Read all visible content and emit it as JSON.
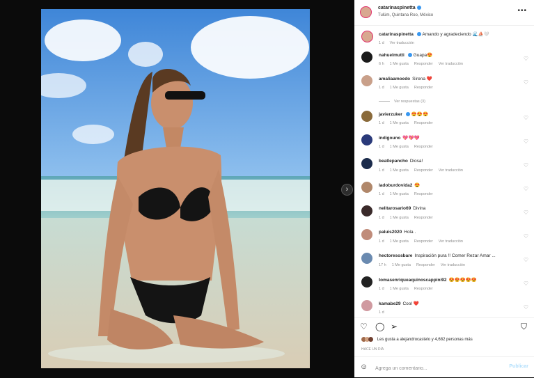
{
  "header": {
    "username": "catarinaspinetta",
    "location": "Tulúm, Quintana Roo, México",
    "more_icon": "more-icon"
  },
  "caption": {
    "username": "catarinaspinetta",
    "text": "Amando y agradeciendo 🌊⛵🤍",
    "time": "1 d",
    "translation": "Ver traducción"
  },
  "comments": [
    {
      "user": "nahuelmutti",
      "verified": true,
      "text": "Guapa😍",
      "time": "6 h",
      "likes": "1 Me gusta",
      "reply": "Responder",
      "translation": "Ver traducción",
      "avatar_color": "#1a1a1a"
    },
    {
      "user": "amaliaamoedo",
      "verified": false,
      "text": "Sirena ❤️",
      "time": "1 d",
      "likes": "1 Me gusta",
      "reply": "Responder",
      "translation": "",
      "avatar_color": "#c9a08a"
    },
    {
      "user": "javierzuker",
      "verified": true,
      "text": "😍😍😍",
      "time": "1 d",
      "likes": "1 Me gusta",
      "reply": "Responder",
      "translation": "",
      "avatar_color": "#8a6a3a"
    },
    {
      "user": "indigouno",
      "verified": false,
      "text": "💖💖💖",
      "time": "1 d",
      "likes": "1 Me gusta",
      "reply": "Responder",
      "translation": "",
      "avatar_color": "#2a3a7a"
    },
    {
      "user": "beatlepancho",
      "verified": false,
      "text": "Diosa!",
      "time": "1 d",
      "likes": "1 Me gusta",
      "reply": "Responder",
      "translation": "Ver traducción",
      "avatar_color": "#1c2c4c"
    },
    {
      "user": "ladoburdovida2",
      "verified": false,
      "text": "😍",
      "time": "1 d",
      "likes": "1 Me gusta",
      "reply": "Responder",
      "translation": "",
      "avatar_color": "#b0876a"
    },
    {
      "user": "nelitarosario69",
      "verified": false,
      "text": "Divina",
      "time": "1 d",
      "likes": "1 Me gusta",
      "reply": "Responder",
      "translation": "",
      "avatar_color": "#3a2a2a"
    },
    {
      "user": "paluis2020",
      "verified": false,
      "text": "Hola .",
      "time": "1 d",
      "likes": "1 Me gusta",
      "reply": "Responder",
      "translation": "Ver traducción",
      "avatar_color": "#c08c7a"
    },
    {
      "user": "hectoresosbare",
      "verified": false,
      "text": "Inspiración pura !! Comer Rezar Amar ...",
      "time": "17 h",
      "likes": "1 Me gusta",
      "reply": "Responder",
      "translation": "Ver traducción",
      "avatar_color": "#6a8ab0"
    },
    {
      "user": "tomasenriqueaquinoscappini92",
      "verified": false,
      "text": "😍😍😍😍😍",
      "time": "1 d",
      "likes": "1 Me gusta",
      "reply": "Responder",
      "translation": "",
      "avatar_color": "#222222"
    },
    {
      "user": "kamabe29",
      "verified": false,
      "text": "Cool ❤️",
      "time": "1 d",
      "likes": "",
      "reply": "",
      "translation": "",
      "avatar_color": "#d09aa0"
    }
  ],
  "view_replies": "Ver respuestas (3)",
  "likes_line": "Les gusta a alejandrocastelo y 4,682 personas más",
  "date": "HACE UN DÍA",
  "add_comment": {
    "placeholder": "Agrega un comentario...",
    "post_label": "Publicar"
  },
  "colors": {
    "accent": "#3897f0",
    "post_disabled": "#b2dffc",
    "story_ring": "#e1306c"
  }
}
